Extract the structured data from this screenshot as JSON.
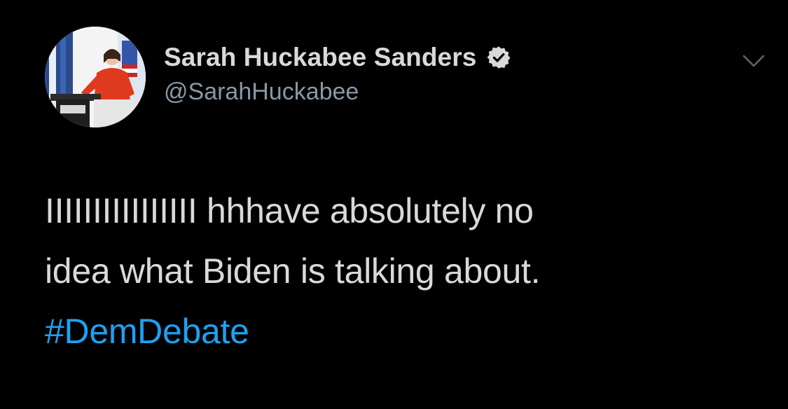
{
  "tweet": {
    "author": {
      "display_name": "Sarah Huckabee Sanders",
      "handle": "@SarahHuckabee",
      "verified": true,
      "avatar_icon": "avatar-photo"
    },
    "text_lines": [
      "IIIIIIIIIIIIIIII hhhave absolutely no",
      "idea what Biden is talking about."
    ],
    "hashtag": "#DemDebate",
    "menu_icon": "chevron-down-icon"
  },
  "colors": {
    "background": "#000000",
    "text": "#d9d9d9",
    "secondary": "#8899a6",
    "link": "#1da1f2"
  }
}
